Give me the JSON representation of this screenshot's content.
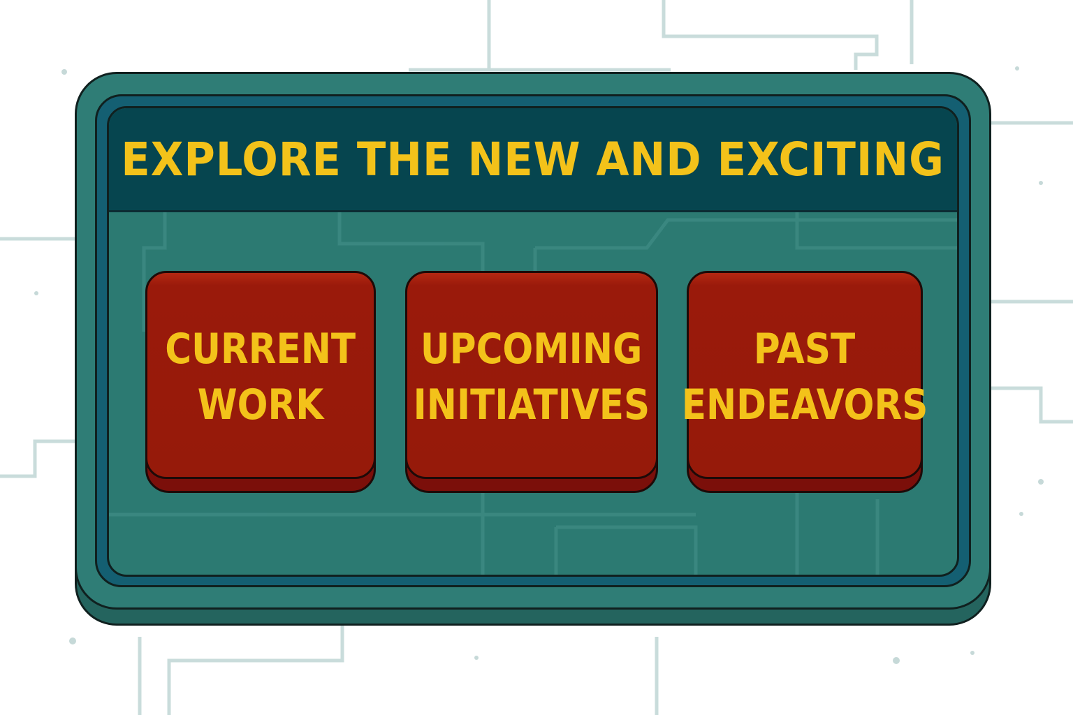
{
  "header": {
    "title": "EXPLORE THE NEW AND EXCITING"
  },
  "buttons": [
    {
      "line1": "CURRENT",
      "line2": "WORK"
    },
    {
      "line1": "UPCOMING",
      "line2": "INITIATIVES"
    },
    {
      "line1": "PAST",
      "line2": "ENDEAVORS"
    }
  ],
  "colors": {
    "panel_teal": "#2f7d76",
    "header_dark_teal": "#06454f",
    "button_red": "#961a0a",
    "text_yellow": "#f3c21a"
  }
}
